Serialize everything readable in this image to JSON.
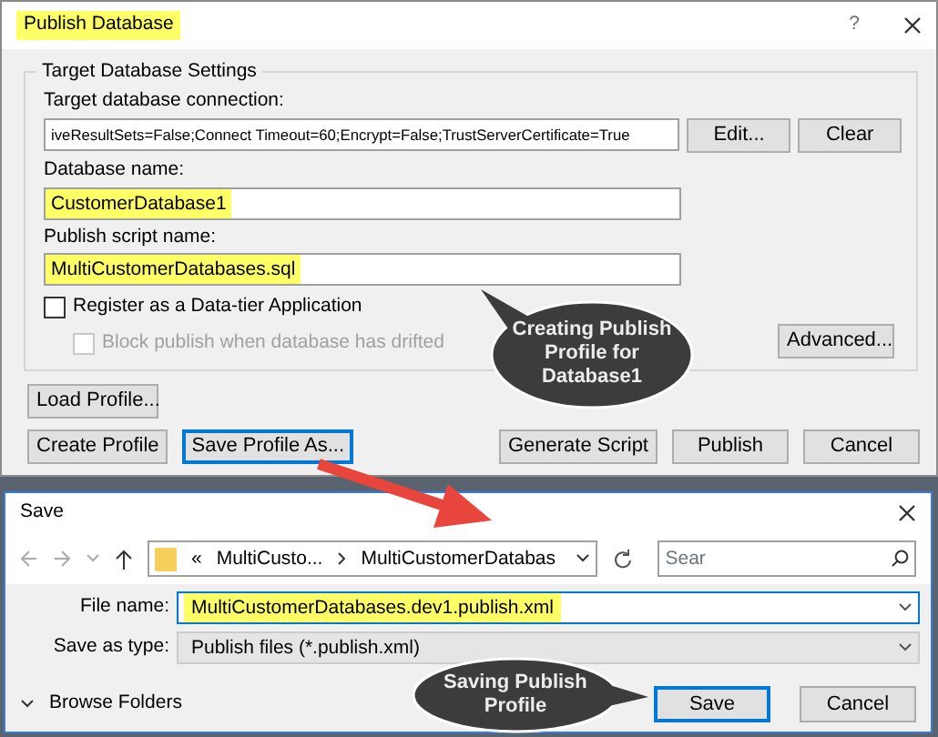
{
  "publish_dialog": {
    "title": "Publish Database",
    "title_highlighted": true,
    "help": "?",
    "group_title": "Target Database Settings",
    "connection": {
      "label": "Target database connection:",
      "value": "iveResultSets=False;Connect Timeout=60;Encrypt=False;TrustServerCertificate=True"
    },
    "connection_buttons": [
      "Edit...",
      "Clear"
    ],
    "fields": [
      {
        "label": "Database name:",
        "value": "CustomerDatabase1",
        "highlighted": true
      },
      {
        "label": "Publish script name:",
        "value": "MultiCustomerDatabases.sql",
        "highlighted": true
      }
    ],
    "checkboxes": [
      {
        "label": "Register as a Data-tier Application",
        "checked": false,
        "disabled": false
      },
      {
        "label": "Block publish when database has drifted",
        "checked": false,
        "disabled": true
      }
    ],
    "advanced_button": "Advanced...",
    "load_button": "Load Profile...",
    "buttons": [
      {
        "label": "Create Profile",
        "focused": false
      },
      {
        "label": "Save Profile As...",
        "focused": true
      },
      {
        "label": "Generate Script",
        "focused": false
      },
      {
        "label": "Publish",
        "focused": false
      },
      {
        "label": "Cancel",
        "focused": false
      }
    ]
  },
  "save_dialog": {
    "title": "Save",
    "breadcrumb_overflow": "«",
    "breadcrumb": [
      "MultiCusto...",
      "MultiCustomerDatabas"
    ],
    "search_placeholder": "Sear",
    "file_name": {
      "label": "File name:",
      "value": "MultiCustomerDatabases.dev1.publish.xml",
      "highlighted": true
    },
    "save_type": {
      "label": "Save as type:",
      "value": "Publish files (*.publish.xml)"
    },
    "browse_folders": "Browse Folders",
    "buttons": [
      {
        "label": "Save",
        "default": true
      },
      {
        "label": "Cancel",
        "default": false
      }
    ]
  },
  "callouts": [
    {
      "text": "Creating Publish Profile for Database1"
    },
    {
      "text": "Saving Publish Profile"
    }
  ]
}
